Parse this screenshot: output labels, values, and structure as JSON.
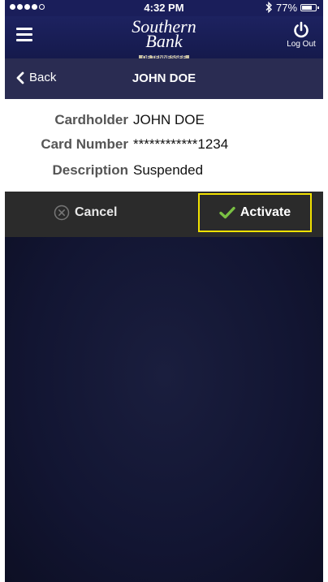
{
  "status_bar": {
    "time": "4:32 PM",
    "battery": "77%",
    "battery_level": 0.77,
    "signal_bars_filled": 4,
    "signal_bars_total": 5
  },
  "header": {
    "logo": {
      "line1": "Southern",
      "line2": "Bank",
      "line3": "OF TENNESSEE"
    },
    "logout_label": "Log Out"
  },
  "nav": {
    "back_label": "Back",
    "title": "JOHN DOE"
  },
  "details": {
    "cardholder_label": "Cardholder",
    "cardholder_value": "JOHN DOE",
    "card_number_label": "Card Number",
    "card_number_value": "************1234",
    "description_label": "Description",
    "description_value": "Suspended"
  },
  "actions": {
    "cancel_label": "Cancel",
    "activate_label": "Activate",
    "highlight_color": "#f2e200",
    "check_color": "#7ac143"
  },
  "icons": {
    "menu": "menu-icon",
    "power": "power-icon",
    "back": "chevron-left-icon",
    "cancel": "close-circle-icon",
    "activate": "checkmark-icon",
    "bluetooth": "bluetooth-icon"
  }
}
